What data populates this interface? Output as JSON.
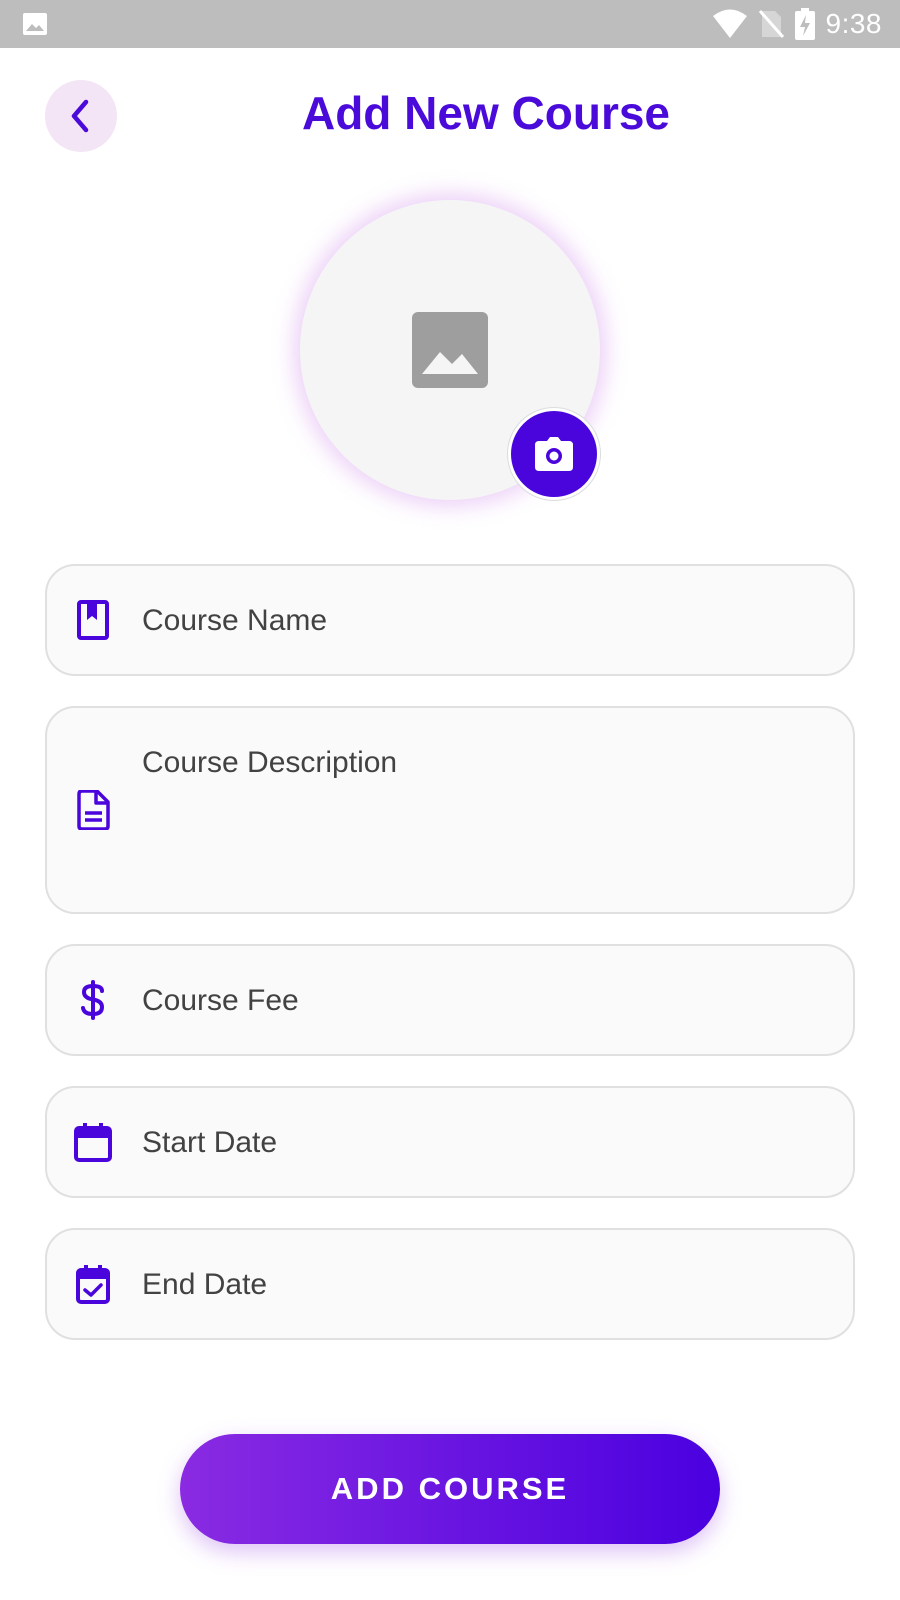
{
  "status_bar": {
    "time": "9:38"
  },
  "header": {
    "title": "Add New Course"
  },
  "form": {
    "course_name_label": "Course Name",
    "course_description_label": "Course Description",
    "course_fee_label": "Course Fee",
    "start_date_label": "Start Date",
    "end_date_label": "End Date"
  },
  "actions": {
    "add_course_label": "ADD COURSE"
  },
  "icons": {
    "back": "chevron-left-icon",
    "image_placeholder": "image-icon",
    "camera": "camera-icon",
    "course_name": "bookmark-book-icon",
    "course_description": "document-icon",
    "course_fee": "dollar-icon",
    "start_date": "calendar-icon",
    "end_date": "calendar-check-icon"
  },
  "colors": {
    "primary": "#4a0ada",
    "gradient_start": "#8a2be2",
    "gradient_end": "#4a00e0",
    "field_bg": "#fafafa",
    "field_border": "#e0e0e0",
    "status_bar": "#bdbdbd",
    "back_button_bg": "#f3e5f5"
  }
}
